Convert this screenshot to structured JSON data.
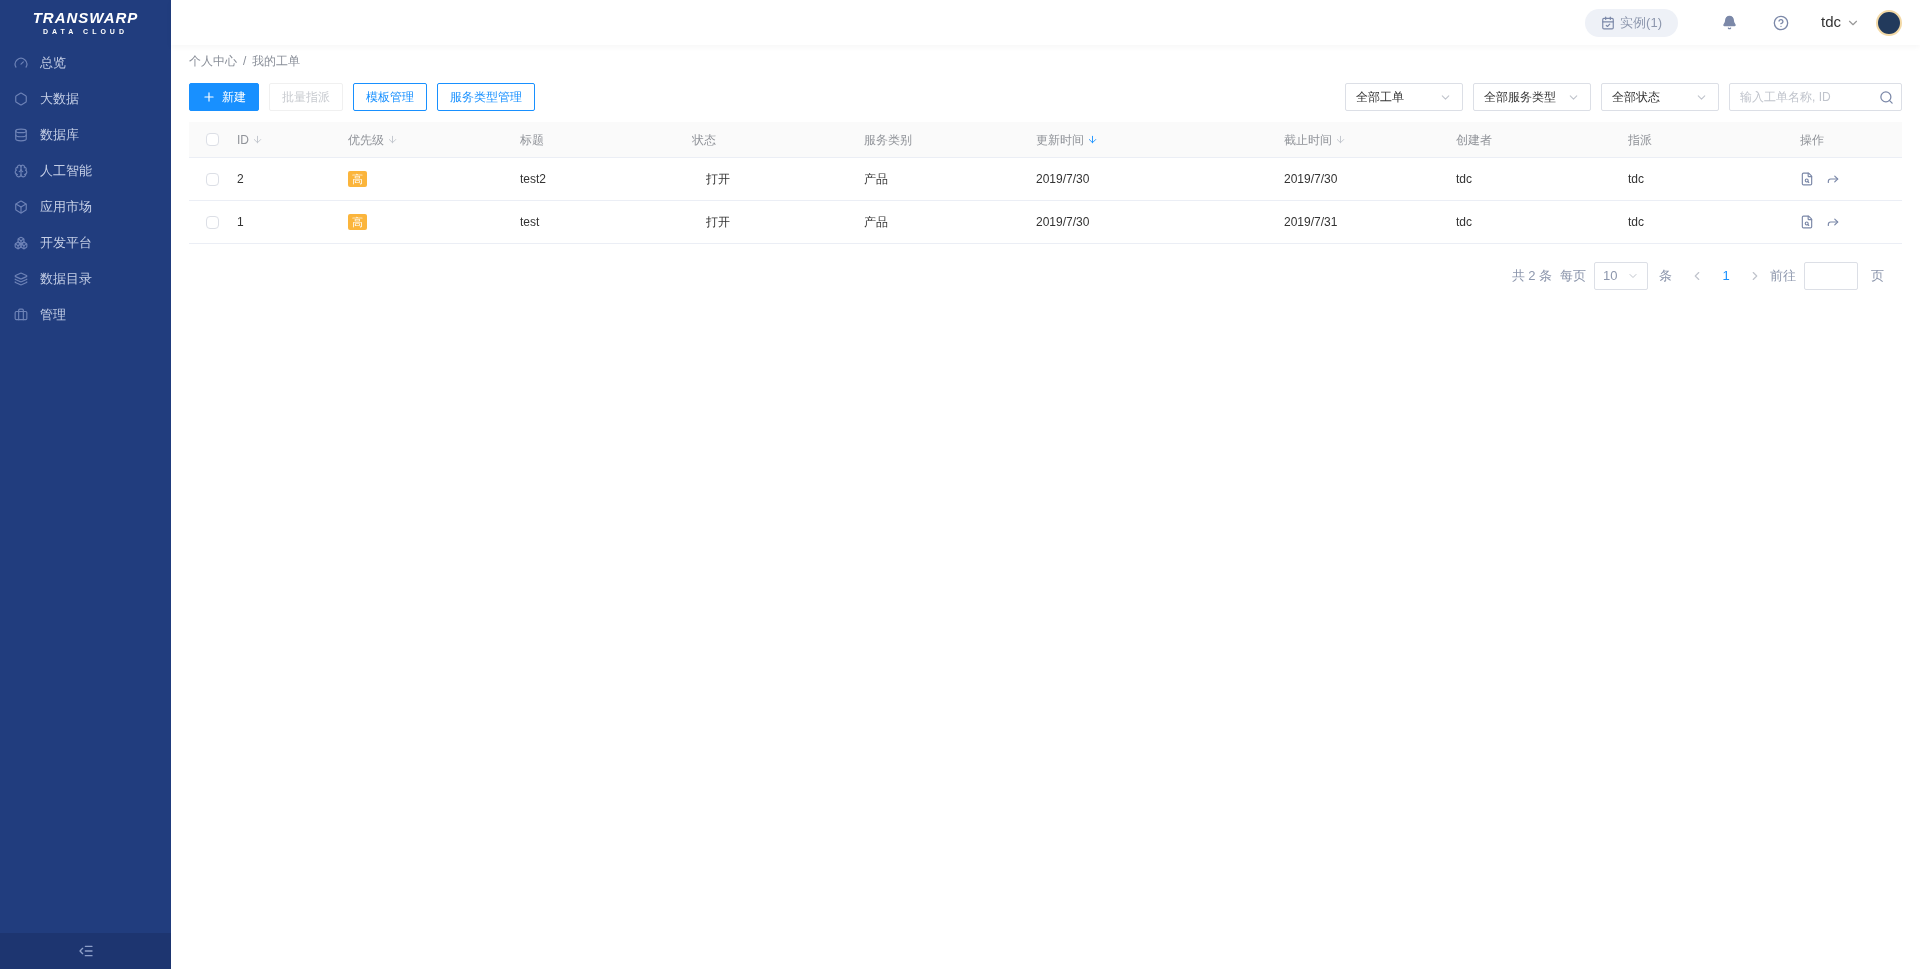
{
  "logo": {
    "name": "TRANSWARP",
    "tagline": "DATA CLOUD"
  },
  "sidebar": {
    "items": [
      {
        "label": "总览",
        "selected": false
      },
      {
        "label": "大数据",
        "selected": false
      },
      {
        "label": "数据库",
        "selected": false
      },
      {
        "label": "人工智能",
        "selected": false
      },
      {
        "label": "应用市场",
        "selected": false
      },
      {
        "label": "开发平台",
        "selected": false
      },
      {
        "label": "数据目录",
        "selected": false
      },
      {
        "label": "管理",
        "selected": false
      }
    ]
  },
  "header": {
    "instances": "实例(1)",
    "user": "tdc"
  },
  "breadcrumb": {
    "separator": "/",
    "items": [
      "个人中心",
      "我的工单"
    ]
  },
  "toolbar": {
    "buttons": [
      {
        "label": "新建",
        "kind": "primary",
        "disabled": false
      },
      {
        "label": "批量指派",
        "kind": "plain",
        "disabled": true
      },
      {
        "label": "模板管理",
        "kind": "outline",
        "disabled": false
      },
      {
        "label": "服务类型管理",
        "kind": "outline",
        "disabled": false
      }
    ],
    "filters": [
      "全部工单",
      "全部服务类型",
      "全部状态"
    ],
    "search": {
      "placeholder": "输入工单名称, ID"
    }
  },
  "table": {
    "all_checked": false,
    "columns": [
      {
        "label": "ID",
        "sortable": true,
        "sorted": false
      },
      {
        "label": "优先级",
        "sortable": true,
        "sorted": false
      },
      {
        "label": "标题",
        "sortable": false
      },
      {
        "label": "状态",
        "sortable": false
      },
      {
        "label": "服务类别",
        "sortable": false
      },
      {
        "label": "更新时间",
        "sortable": true,
        "sorted": true
      },
      {
        "label": "截止时间",
        "sortable": true,
        "sorted": false
      },
      {
        "label": "创建者",
        "sortable": false
      },
      {
        "label": "指派",
        "sortable": false
      },
      {
        "label": "操作",
        "sortable": false
      }
    ],
    "rows": [
      {
        "checked": false,
        "id": "2",
        "priority": "高",
        "title": "test2",
        "status": "打开",
        "service": "产品",
        "updated": "2019/7/30",
        "deadline": "2019/7/30",
        "creator": "tdc",
        "assignee": "tdc"
      },
      {
        "checked": false,
        "id": "1",
        "priority": "高",
        "title": "test",
        "status": "打开",
        "service": "产品",
        "updated": "2019/7/30",
        "deadline": "2019/7/31",
        "creator": "tdc",
        "assignee": "tdc"
      }
    ]
  },
  "pagination": {
    "total": "共 2 条",
    "per_page_label": "每页",
    "page_size": "10",
    "unit": "条",
    "pages": [
      {
        "label": "1",
        "selected": true
      }
    ],
    "goto_label": "前往",
    "goto_unit": "页"
  }
}
